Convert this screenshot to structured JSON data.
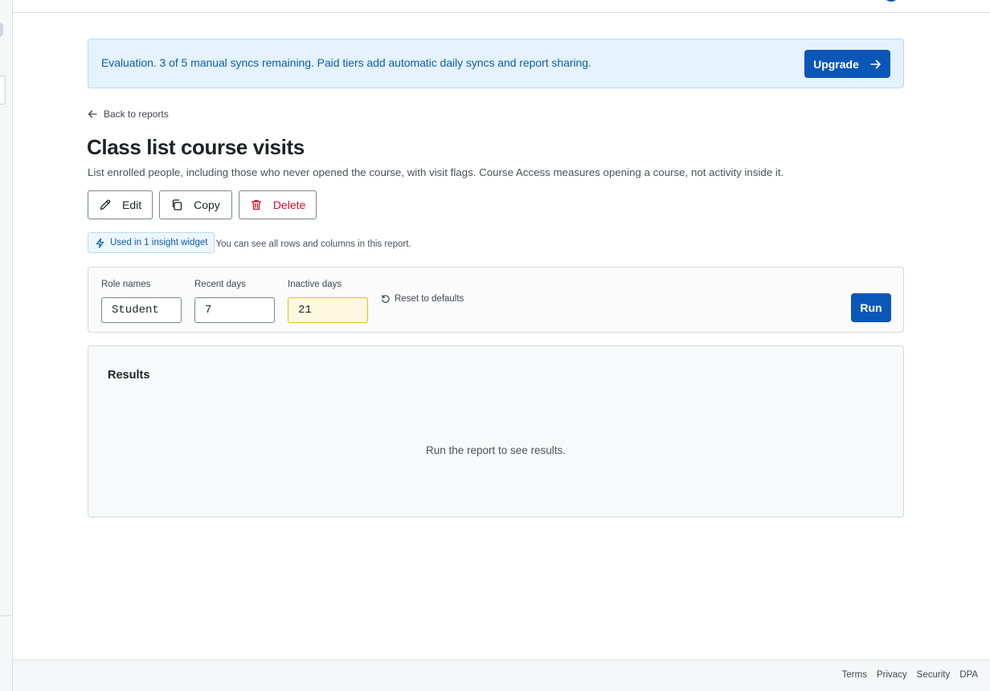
{
  "banner": {
    "message": "Evaluation. 3 of 5 manual syncs remaining. Paid tiers add automatic daily syncs and report sharing.",
    "upgrade_label": "Upgrade"
  },
  "nav": {
    "back_label": "Back to reports"
  },
  "report": {
    "title": "Class list course visits",
    "description": "List enrolled people, including those who never opened the course, with visit flags. Course Access measures opening a course, not activity inside it."
  },
  "actions": {
    "edit_label": "Edit",
    "copy_label": "Copy",
    "delete_label": "Delete"
  },
  "meta": {
    "widget_badge": "Used in 1 insight widget",
    "access_note": "You can see all rows and columns in this report."
  },
  "parameters": {
    "role_names": {
      "label": "Role names",
      "value": "Student"
    },
    "recent_days": {
      "label": "Recent days",
      "value": "7"
    },
    "inactive_days": {
      "label": "Inactive days",
      "value": "21"
    },
    "reset_label": "Reset to defaults",
    "run_label": "Run"
  },
  "results": {
    "title": "Results",
    "empty_message": "Run the report to see results."
  },
  "footer": {
    "links": [
      "Terms",
      "Privacy",
      "Security",
      "DPA"
    ]
  },
  "colors": {
    "primary": "#0b57b7",
    "banner_bg": "#e4f2fc",
    "danger": "#c8102e",
    "warn_bg": "#fff8e0"
  },
  "icons": {
    "upgrade": "arrow-right-icon",
    "back": "arrow-left-icon",
    "edit": "pencil-icon",
    "copy": "copy-icon",
    "delete": "trash-icon",
    "widget": "lightning-icon",
    "reset": "reset-icon"
  }
}
